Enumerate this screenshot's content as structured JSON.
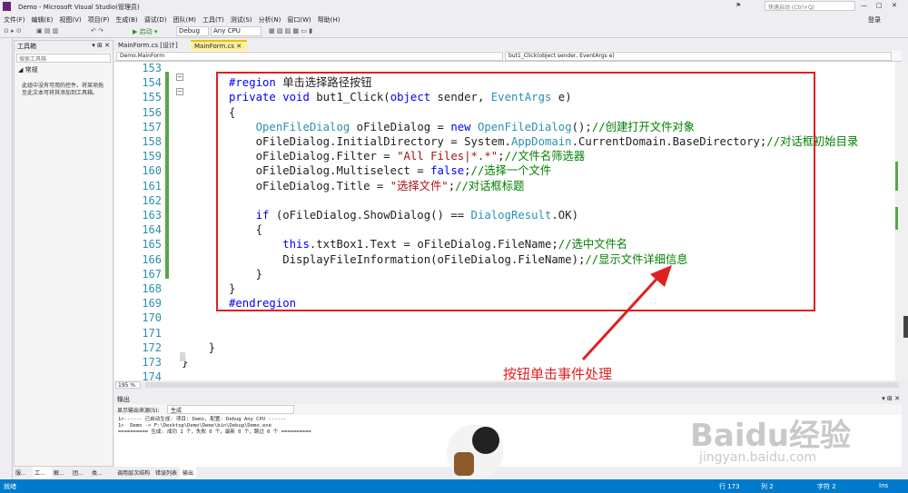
{
  "window": {
    "title": "Demo - Microsoft Visual Studio(管理员)",
    "quick_launch": "快速启动 (Ctrl+Q)",
    "login": "登录"
  },
  "menu": [
    "文件(F)",
    "编辑(E)",
    "视图(V)",
    "项目(P)",
    "生成(B)",
    "调试(D)",
    "团队(M)",
    "工具(T)",
    "测试(S)",
    "分析(N)",
    "窗口(W)",
    "帮助(H)"
  ],
  "toolbar": {
    "start": "▶ 启动 ▾",
    "config": "Debug",
    "platform": "Any CPU"
  },
  "toolbox": {
    "title": "工具箱",
    "search": "搜索工具箱",
    "group": "◢ 常规",
    "empty": "此组中没有可用的控件。将某项拖至此文本可将其添加到工具箱。"
  },
  "tabs": [
    {
      "label": "MainForm.cs [设计]",
      "active": false
    },
    {
      "label": "MainForm.cs ✕",
      "active": true
    }
  ],
  "nav": {
    "left": "Demo.MainForm",
    "right": "but1_Click(object sender, EventArgs e)"
  },
  "code": [
    {
      "n": "153",
      "t": ""
    },
    {
      "n": "154",
      "t": "#region 单击选择路径按钮"
    },
    {
      "n": "155",
      "t": "private void but1_Click(object sender, EventArgs e)"
    },
    {
      "n": "156",
      "t": "{"
    },
    {
      "n": "157",
      "t": "    OpenFileDialog oFileDialog = new OpenFileDialog();//创建打开文件对象"
    },
    {
      "n": "158",
      "t": "    oFileDialog.InitialDirectory = System.AppDomain.CurrentDomain.BaseDirectory;//对话框初始目录"
    },
    {
      "n": "159",
      "t": "    oFileDialog.Filter = \"All Files|*.*\";//文件名筛选器"
    },
    {
      "n": "160",
      "t": "    oFileDialog.Multiselect = false;//选择一个文件"
    },
    {
      "n": "161",
      "t": "    oFileDialog.Title = \"选择文件\";//对话框标题"
    },
    {
      "n": "162",
      "t": ""
    },
    {
      "n": "163",
      "t": "    if (oFileDialog.ShowDialog() == DialogResult.OK)"
    },
    {
      "n": "164",
      "t": "    {"
    },
    {
      "n": "165",
      "t": "        this.txtBox1.Text = oFileDialog.FileName;//选中文件名"
    },
    {
      "n": "166",
      "t": "        DisplayFileInformation(oFileDialog.FileName);//显示文件详细信息"
    },
    {
      "n": "167",
      "t": "    }"
    },
    {
      "n": "168",
      "t": "}"
    },
    {
      "n": "169",
      "t": "#endregion"
    },
    {
      "n": "170",
      "t": ""
    },
    {
      "n": "171",
      "t": ""
    },
    {
      "n": "172",
      "t": "    }"
    },
    {
      "n": "173",
      "t": "}"
    },
    {
      "n": "174",
      "t": ""
    }
  ],
  "annotation": "按钮单击事件处理",
  "zoom": "195 %",
  "output": {
    "title": "输出",
    "source_label": "显示输出来源(S):",
    "source_value": "生成",
    "lines": [
      "1>------ 已启动生成: 项目: Demo, 配置: Debug Any CPU ------",
      "1>  Demo -> F:\\Desktop\\Demo\\Demo\\bin\\Debug\\Demo.exe",
      "========== 生成: 成功 1 个，失败 0 个，最新 0 个，跳过 0 个 =========="
    ]
  },
  "bottom_tabs": [
    "调用层次结构",
    "错误列表",
    "输出"
  ],
  "left_tabs": [
    "服...",
    "工...",
    "解...",
    "团...",
    "类..."
  ],
  "status": {
    "left": "就绪",
    "line": "行 173",
    "col": "列 2",
    "char": "字符 2",
    "mode": "Ins"
  },
  "watermark": {
    "text": "Baidu经验",
    "url": "jingyan.baidu.com"
  }
}
